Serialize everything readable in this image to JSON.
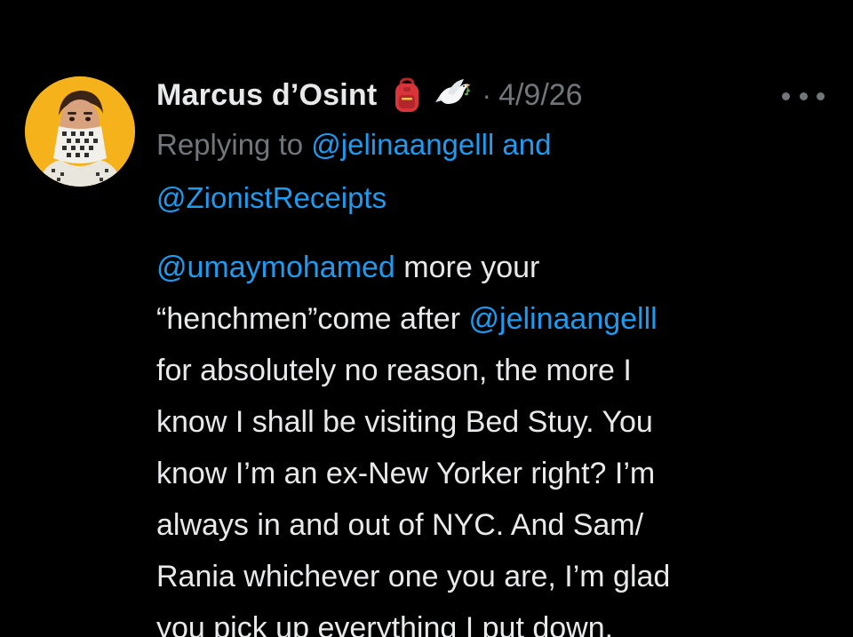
{
  "author": {
    "display_name": "Marcus d’Osint",
    "badges": [
      "backpack-emoji",
      "dove-emoji"
    ],
    "date": "4/9/26",
    "separator": "·"
  },
  "reply_context": {
    "prefix": "Replying to",
    "mention_1": "@jelinaangelll",
    "joiner": "and",
    "mention_2": "@ZionistReceipts"
  },
  "body": {
    "line1_mention": "@umaymohamed",
    "line1_text": " more your",
    "line2_text": "“henchmen”come after ",
    "line2_mention": "@jelinaangelll",
    "line3": "for absolutely no reason, the more I",
    "line4": "know I shall be visiting Bed Stuy. You",
    "line5": "know I’m an ex-New Yorker right? I’m",
    "line6": "always in and out of NYC. And Sam/",
    "line7": "Rania whichever one you are, I’m glad",
    "line8": "you pick up everything I put down."
  },
  "colors": {
    "background": "#000000",
    "text": "#e7e9ea",
    "muted": "#71767b",
    "link": "#1d9bf0",
    "avatar_bg": "#f5b21a"
  }
}
